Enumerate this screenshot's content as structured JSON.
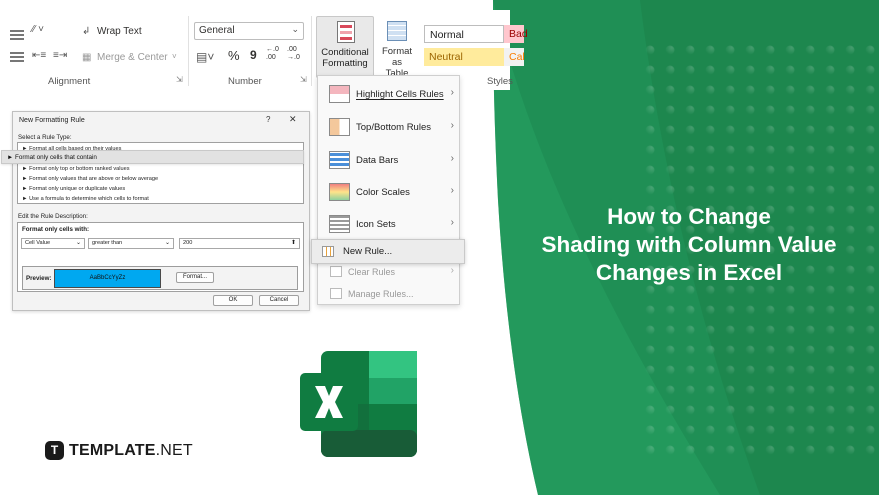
{
  "brand": {
    "name_bold": "TEMPLATE",
    "name_thin": ".NET",
    "mark": "T",
    "accent_color": "#1e8e52"
  },
  "headline": {
    "line1": "How to Change",
    "line2": "Shading with Column Value",
    "line3": "Changes in Excel"
  },
  "ribbon": {
    "wrap_text": "Wrap Text",
    "merge_center": "Merge & Center",
    "alignment_label": "Alignment",
    "number_format": "General",
    "number_label": "Number",
    "percent": "%",
    "comma": "9",
    "inc_decimal": "←.0\n.00",
    "dec_decimal": ".00\n→.0",
    "cf_line1": "Conditional",
    "cf_line2": "Formatting",
    "fat_line1": "Format as",
    "fat_line2": "Table",
    "style_normal": "Normal",
    "style_bad": "Bad",
    "style_neutral": "Neutral",
    "style_calc": "Calcu",
    "styles_label": "Styles"
  },
  "cf_menu": {
    "items": [
      {
        "label": "Highlight Cells Rules",
        "icon": "highlight-cells-icon"
      },
      {
        "label": "Top/Bottom Rules",
        "icon": "top-bottom-icon"
      },
      {
        "label": "Data Bars",
        "icon": "data-bars-icon"
      },
      {
        "label": "Color Scales",
        "icon": "color-scales-icon"
      },
      {
        "label": "Icon Sets",
        "icon": "icon-sets-icon"
      }
    ],
    "new_rule": "New Rule...",
    "clear_rules": "Clear Rules",
    "manage_rules": "Manage Rules..."
  },
  "dialog": {
    "title": "New Formatting Rule",
    "help": "?",
    "close": "✕",
    "select_type_label": "Select a Rule Type:",
    "rule_types": [
      "► Format all cells based on their values",
      "► Format only cells that contain",
      "► Format only top or bottom ranked values",
      "► Format only values that are above or below average",
      "► Format only unique or duplicate values",
      "► Use a formula to determine which cells to format"
    ],
    "edit_desc_label": "Edit the Rule Description:",
    "format_only_label": "Format only cells with:",
    "condition_field": "Cell Value",
    "condition_operator": "greater than",
    "condition_value": "200",
    "preview_label": "Preview:",
    "preview_text": "AaBbCcYyZz",
    "format_button": "Format...",
    "ok_button": "OK",
    "cancel_button": "Cancel"
  }
}
